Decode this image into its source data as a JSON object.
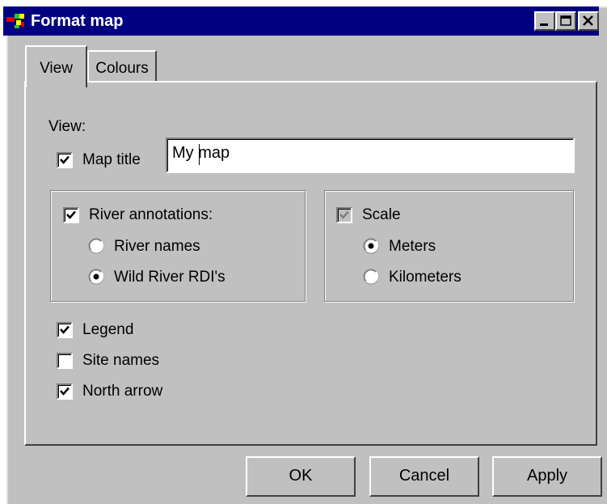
{
  "window": {
    "title": "Format map",
    "controls": [
      "minimize-icon",
      "maximize-icon",
      "close-icon"
    ]
  },
  "tabs": [
    {
      "label": "View",
      "active": true
    },
    {
      "label": "Colours",
      "active": false
    }
  ],
  "view": {
    "section_label": "View:",
    "map_title": {
      "label": "Map title",
      "checked": true,
      "value": "My map"
    },
    "river_annotations": {
      "label": "River annotations:",
      "checked": true,
      "options": [
        {
          "label": "River names",
          "selected": false
        },
        {
          "label": "Wild River RDI's",
          "selected": true
        }
      ]
    },
    "scale": {
      "label": "Scale",
      "checked": true,
      "disabled": true,
      "options": [
        {
          "label": "Meters",
          "selected": true
        },
        {
          "label": "Kilometers",
          "selected": false
        }
      ]
    },
    "legend": {
      "label": "Legend",
      "checked": true
    },
    "site_names": {
      "label": "Site names",
      "checked": false
    },
    "north_arrow": {
      "label": "North arrow",
      "checked": true
    }
  },
  "buttons": {
    "ok": "OK",
    "cancel": "Cancel",
    "apply": "Apply"
  },
  "colors": {
    "titlebar": "#000080",
    "face": "#c0c0c0"
  }
}
